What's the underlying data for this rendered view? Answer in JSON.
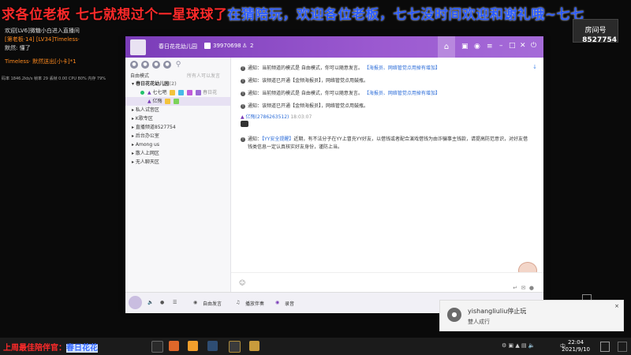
{
  "banner": {
    "red_text": "求各位老板 七七就想过个一星球球了",
    "blue_text": "在猜陪玩，欢迎各位老板，七七没时间欢迎和谢礼哦~七七",
    "room_label": "房间号",
    "room_number": "8527754"
  },
  "chat_overlay": {
    "lines": [
      {
        "text": "欢迎[LV6]微糖小白进入直播间",
        "color": "#dddddd"
      },
      {
        "text": "[第老板·14] [LV34]Timeless·",
        "color": "#ff8a1e"
      },
      {
        "text": "默然: 懂了",
        "color": "#dddddd"
      },
      {
        "text": "Timeless· 默然送出[小卡]*1",
        "color": "#ff8a1e"
      }
    ],
    "stats": "码率 1846.2kb/s 帧率 29 丢帧 0.00 CPU 80% 内存 79%"
  },
  "yy": {
    "channel_name": "春日花花幼儿园",
    "channel_id": "39970698",
    "online_count": "2",
    "mode": "自由模式",
    "search_placeholder": "所有人可以发言",
    "tree": {
      "root": "春日花花幼儿园",
      "root_count": "(2)",
      "members": [
        {
          "name": "七七吧",
          "tag": "春日花"
        },
        {
          "name": "亿殇",
          "tag": ""
        }
      ],
      "subchannels": [
        "私人试音区",
        "K歌专区",
        "直播频道8527754",
        "后台办公室",
        "Among us",
        "散人上网区",
        "无人聊天区"
      ]
    },
    "messages": [
      {
        "prefix": "通知：",
        "body": "当前频道的模式是 自由模式，你可以随意发言。",
        "link": "【海报员、网络管觉点用掉有增加】"
      },
      {
        "prefix": "通知：",
        "body": "该频道已开通【金频海报员】，网络管觉点用鼓瓶。",
        "link": ""
      },
      {
        "prefix": "通知：",
        "body": "当前频道的模式是 自由模式，你可以随意发言。",
        "link": "【海报员、网络管觉点用掉有增加】"
      },
      {
        "prefix": "通知：",
        "body": "该频道已开通【金频海报员】，网络管觉点用鼓瓶。",
        "link": ""
      }
    ],
    "user_message": {
      "name": "亿殇(2786263512)",
      "time": "18:03:07"
    },
    "security_notice": {
      "prefix": "通知：",
      "label": "【YY安全提醒】",
      "line1": "近期，有不法分子在YY上冒充YY好友，以借钱或者配合演戏借钱为由诈骗事主钱款，请提高防范意识，对好友借",
      "line2": "钱类信息一定认真核实好友身份，谨防上当。"
    },
    "bottom_bar": {
      "free_speech": "自由发言",
      "play_music": "播放伴奏",
      "record": "录音"
    }
  },
  "toast": {
    "title": "yishangliuliu停止玩",
    "subtitle": "雙人成行",
    "close": "×"
  },
  "taskbar": {
    "marquee_red": "上周最佳陪伴官：",
    "marquee_blue": "春日花花",
    "time": "22:04",
    "date": "2021/9/10"
  },
  "colors": {
    "title_bar": "#8a4bc6",
    "banner_red": "#ff2a2a",
    "banner_blue": "#2b5bff"
  }
}
